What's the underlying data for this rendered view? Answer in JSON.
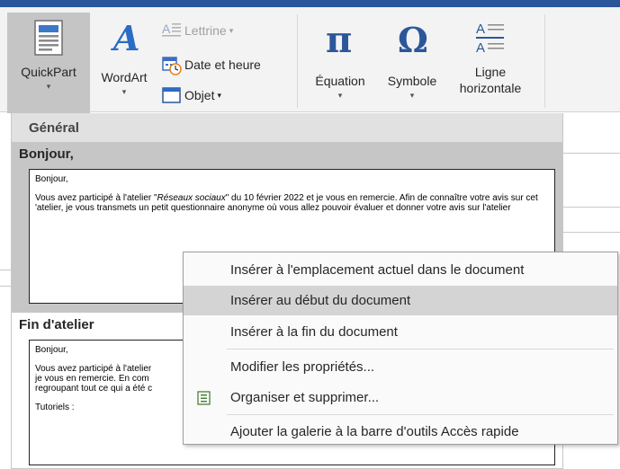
{
  "ribbon": {
    "quickpart_label": "QuickPart",
    "wordart_label": "WordArt",
    "lettrine_label": "Lettrine",
    "datetime_label": "Date et heure",
    "objet_label": "Objet",
    "equation_label": "Équation",
    "symbole_label": "Symbole",
    "ligne_label_1": "Ligne",
    "ligne_label_2": "horizontale",
    "caret": "▾"
  },
  "gallery": {
    "category": "Général",
    "entries": [
      {
        "title": "Bonjour,",
        "preview": {
          "p1": "Bonjour,",
          "p2_a": "Vous avez participé à l'atelier \"",
          "p2_em": "Réseaux sociaux",
          "p2_b": "\" du 10 février 2022 et je vous en remercie. Afin de connaître votre avis sur cet 'atelier, je vous transmets un petit questionnaire anonyme où vous allez pouvoir évaluer et donner votre avis sur l'atelier"
        }
      },
      {
        "title": "Fin d'atelier",
        "preview": {
          "p1": "Bonjour,",
          "p2": "Vous avez participé à l'atelier",
          "p2_line2": "je vous en remercie. En com",
          "p2_line3": "regroupant tout ce qui a été c",
          "p3": "Tutoriels :"
        }
      }
    ]
  },
  "context_menu": {
    "items": [
      {
        "label": "Insérer à l'emplacement actuel dans le document"
      },
      {
        "label": "Insérer au début du document"
      },
      {
        "label": "Insérer à la fin du document"
      },
      {
        "label": "Modifier les propriétés..."
      },
      {
        "label": "Organiser et supprimer..."
      },
      {
        "label": "Ajouter la galerie à la barre d'outils Accès rapide"
      }
    ],
    "highlighted_index": 1
  },
  "colors": {
    "title_bar": "#2b579a",
    "ribbon_bg": "#f3f3f3",
    "icon_blue": "#2b579a",
    "selected_bg": "#c6c6c6",
    "menu_highlight": "#d4d4d4"
  }
}
